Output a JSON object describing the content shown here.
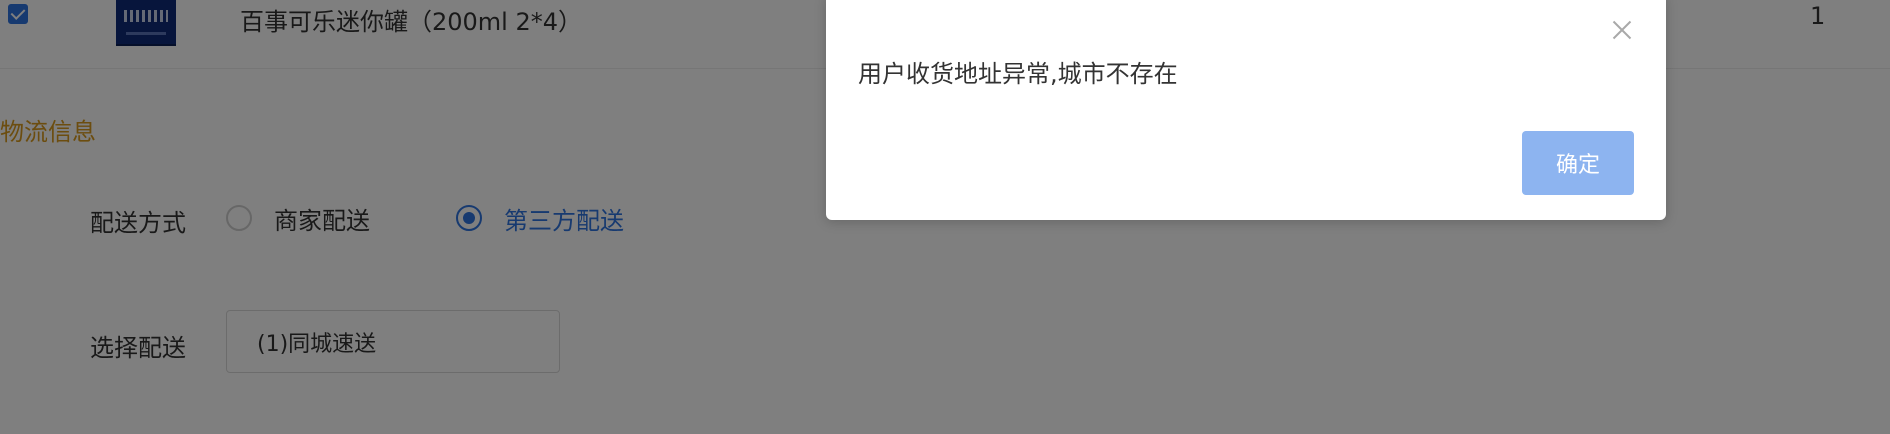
{
  "product": {
    "name": "百事可乐迷你罐（200ml 2*4）",
    "quantity": "1",
    "checked": true
  },
  "logistics": {
    "section_title": "物流信息",
    "delivery_method_label": "配送方式",
    "options": [
      {
        "label": "商家配送",
        "selected": false
      },
      {
        "label": "第三方配送",
        "selected": true
      }
    ],
    "select_delivery_label": "选择配送",
    "select_delivery_value": "(1)同城速送"
  },
  "dialog": {
    "message": "用户收货地址异常,城市不存在",
    "confirm_label": "确定",
    "close_icon": "close-icon"
  },
  "colors": {
    "accent": "#2f74e0",
    "section_title": "#d89a1e",
    "confirm_button": "#8db4f0",
    "mask": "rgba(0,0,0,0.5)"
  }
}
